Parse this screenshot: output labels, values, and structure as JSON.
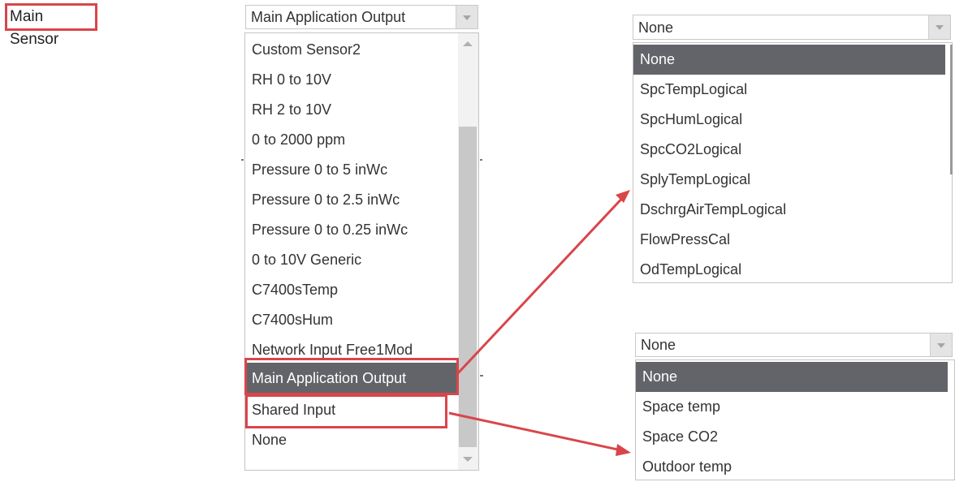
{
  "main_sensor_label": "Main Sensor",
  "sensor_type": {
    "selected": "Main Application Output",
    "options": [
      "Custom Sensor2",
      "RH 0 to 10V",
      "RH 2 to 10V",
      "0 to 2000 ppm",
      "Pressure 0 to 5 inWc",
      "Pressure 0 to 2.5 inWc",
      "Pressure 0 to 0.25 inWc",
      "0 to 10V Generic",
      "C7400sTemp",
      "C7400sHum",
      "Network Input Free1Mod",
      "Main Application Output",
      "Shared Input",
      "None"
    ],
    "highlighted": "Main Application Output"
  },
  "app_output_select": {
    "selected": "None",
    "options": [
      "None",
      "SpcTempLogical",
      "SpcHumLogical",
      "SpcCO2Logical",
      "SplyTempLogical",
      "DschrgAirTempLogical",
      "FlowPressCal",
      "OdTempLogical"
    ]
  },
  "shared_input_select": {
    "selected": "None",
    "options": [
      "None",
      "Space temp",
      "Space CO2",
      "Outdoor temp"
    ]
  },
  "colors": {
    "annotation_red": "#d9454a",
    "highlight_bg": "#636469"
  }
}
